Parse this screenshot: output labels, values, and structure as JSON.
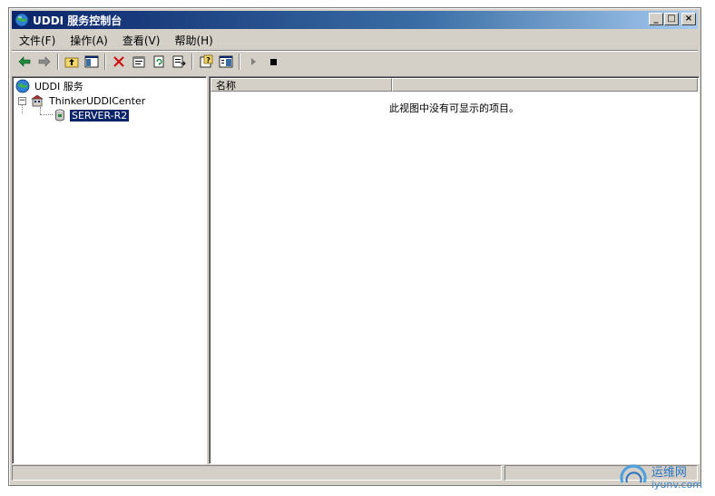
{
  "window": {
    "title": "UDDI 服务控制台",
    "controls": {
      "minimize": "_",
      "maximize": "□",
      "close": "×"
    }
  },
  "menu": [
    {
      "label": "文件(F)"
    },
    {
      "label": "操作(A)"
    },
    {
      "label": "查看(V)"
    },
    {
      "label": "帮助(H)"
    }
  ],
  "toolbar": {
    "icons": [
      "back-arrow-icon",
      "forward-arrow-icon",
      "up-folder-icon",
      "show-hide-tree-icon",
      "delete-icon",
      "properties-icon",
      "refresh-icon",
      "export-list-icon",
      "help-icon",
      "console-icon",
      "play-icon",
      "stop-icon"
    ]
  },
  "tree": {
    "root": {
      "label": "UDDI 服务",
      "icon": "globe-icon"
    },
    "site": {
      "label": "ThinkerUDDICenter",
      "icon": "site-icon",
      "expander": "−"
    },
    "server": {
      "label": "SERVER-R2",
      "icon": "database-server-icon"
    }
  },
  "list": {
    "columns": [
      {
        "label": "名称"
      },
      {
        "label": ""
      }
    ],
    "empty_message": "此视图中没有可显示的项目。"
  },
  "watermark": {
    "brand": "运维网",
    "url": "iyunv.com"
  },
  "colors": {
    "title_start": "#0a246a",
    "title_end": "#a6caf0",
    "chrome": "#d4d0c8",
    "selection": "#0a246a"
  }
}
